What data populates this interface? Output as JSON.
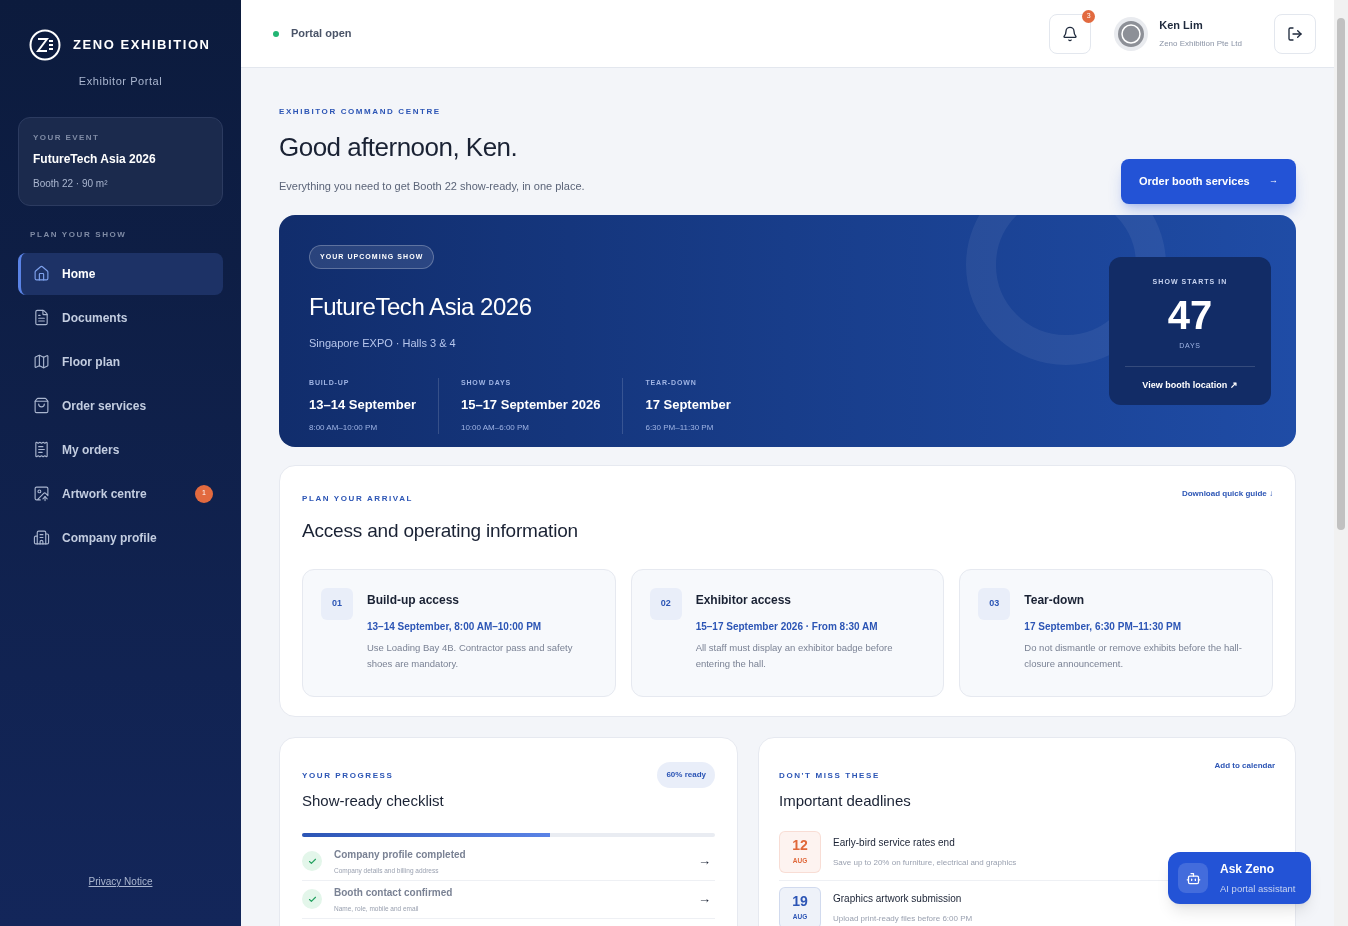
{
  "brand": {
    "name": "ZENO EXHIBITION",
    "subtitle": "Exhibitor Portal"
  },
  "event_card": {
    "label": "YOUR EVENT",
    "name": "FutureTech Asia 2026",
    "detail": "Booth 22 · 90 m²"
  },
  "nav": {
    "heading": "PLAN YOUR SHOW",
    "items": [
      {
        "label": "Home",
        "selected": true
      },
      {
        "label": "Documents",
        "selected": false
      },
      {
        "label": "Floor plan",
        "selected": false
      },
      {
        "label": "Order services",
        "selected": false
      },
      {
        "label": "My orders",
        "selected": false
      },
      {
        "label": "Artwork centre",
        "selected": false,
        "badge": "1"
      },
      {
        "label": "Company profile",
        "selected": false
      }
    ]
  },
  "privacy_link": "Privacy Notice",
  "header": {
    "status": "Portal open",
    "notification_count": "3",
    "user_name": "Ken Lim",
    "company": "Zeno Exhibition Pte Ltd"
  },
  "intro": {
    "eyebrow": "EXHIBITOR COMMAND CENTRE",
    "greeting": "Good afternoon, Ken.",
    "subtitle": "Everything you need to get Booth 22 show-ready, in one place.",
    "cta": "Order booth services",
    "cta_arrow": "→"
  },
  "hero": {
    "pill": "YOUR UPCOMING SHOW",
    "title": "FutureTech Asia 2026",
    "venue": "Singapore EXPO · Halls 3 & 4",
    "phases": [
      {
        "label": "BUILD-UP",
        "date": "13–14 September",
        "time": "8:00 AM–10:00 PM"
      },
      {
        "label": "SHOW DAYS",
        "date": "15–17 September 2026",
        "time": "10:00 AM–6:00 PM"
      },
      {
        "label": "TEAR-DOWN",
        "date": "17 September",
        "time": "6:30 PM–11:30 PM"
      }
    ],
    "countdown": {
      "label": "SHOW STARTS IN",
      "number": "47",
      "unit": "DAYS",
      "link": "View booth location ↗"
    }
  },
  "access": {
    "eyebrow": "PLAN YOUR ARRIVAL",
    "title": "Access and operating information",
    "link": "Download quick guide ↓",
    "cards": [
      {
        "number": "01",
        "title": "Build-up access",
        "when": "13–14 September, 8:00 AM–10:00 PM",
        "note": "Use Loading Bay 4B. Contractor pass and safety shoes are mandatory."
      },
      {
        "number": "02",
        "title": "Exhibitor access",
        "when": "15–17 September 2026 · From 8:30 AM",
        "note": "All staff must display an exhibitor badge before entering the hall."
      },
      {
        "number": "03",
        "title": "Tear-down",
        "when": "17 September, 6:30 PM–11:30 PM",
        "note": "Do not dismantle or remove exhibits before the hall-closure announcement."
      }
    ]
  },
  "checklist": {
    "eyebrow": "YOUR PROGRESS",
    "title": "Show-ready checklist",
    "badge": "60% ready",
    "level": 0.6,
    "items": [
      {
        "title": "Company profile completed",
        "detail": "Company details and billing address",
        "checked": true,
        "arrow": "→"
      },
      {
        "title": "Booth contact confirmed",
        "detail": "Name, role, mobile and email",
        "checked": true,
        "arrow": "→"
      }
    ]
  },
  "deadlines": {
    "eyebrow": "DON'T MISS THESE",
    "title": "Important deadlines",
    "link": "Add to calendar",
    "items": [
      {
        "day": "12",
        "month": "AUG",
        "title": "Early-bird service rates end",
        "detail": "Save up to 20% on furniture, electrical and graphics",
        "color": "#e0683a"
      },
      {
        "day": "19",
        "month": "AUG",
        "title": "Graphics artwork submission",
        "detail": "Upload print-ready files before 6:00 PM",
        "color": "#2c55b5"
      }
    ]
  },
  "assistant": {
    "title": "Ask Zeno",
    "subtitle": "AI portal assistant"
  }
}
